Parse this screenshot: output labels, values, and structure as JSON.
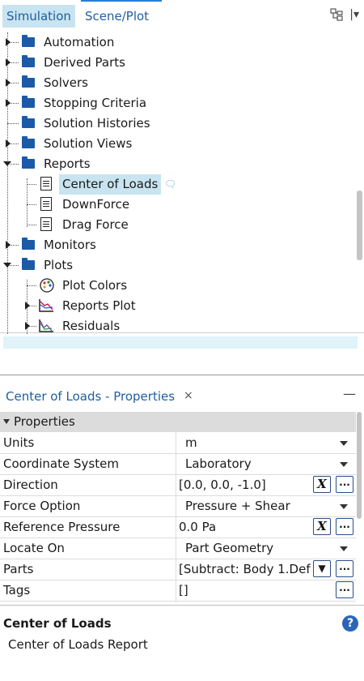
{
  "tabs": [
    {
      "label": "Simulation"
    },
    {
      "label": "Scene/Plot"
    }
  ],
  "tree": {
    "items": [
      {
        "label": "Automation"
      },
      {
        "label": "Derived Parts"
      },
      {
        "label": "Solvers"
      },
      {
        "label": "Stopping Criteria"
      },
      {
        "label": "Solution Histories"
      },
      {
        "label": "Solution Views"
      },
      {
        "label": "Reports"
      },
      {
        "label": "Center of Loads"
      },
      {
        "label": "DownForce"
      },
      {
        "label": "Drag Force"
      },
      {
        "label": "Monitors"
      },
      {
        "label": "Plots"
      },
      {
        "label": "Plot Colors"
      },
      {
        "label": "Reports Plot"
      },
      {
        "label": "Residuals"
      }
    ]
  },
  "properties": {
    "panel_title": "Center of Loads - Properties",
    "close_glyph": "×",
    "minimize_glyph": "—",
    "section_label": "Properties",
    "rows": [
      {
        "name": "Units",
        "value": "m"
      },
      {
        "name": "Coordinate System",
        "value": "Laboratory"
      },
      {
        "name": "Direction",
        "value": "[0.0, 0.0, -1.0]"
      },
      {
        "name": "Force Option",
        "value": "Pressure + Shear"
      },
      {
        "name": "Reference Pressure",
        "value": "0.0 Pa"
      },
      {
        "name": "Locate On",
        "value": "Part Geometry"
      },
      {
        "name": "Parts",
        "value": "[Subtract: Body 1.Def"
      },
      {
        "name": "Tags",
        "value": "[]"
      }
    ],
    "btn_x": "X",
    "btn_dots": "...",
    "btn_filter": "▼"
  },
  "description": {
    "title": "Center of Loads",
    "text": "Center of Loads Report",
    "help": "?"
  },
  "colors": {
    "accent": "#1f5fa0",
    "selection": "#c8e4f0",
    "folder": "#1c5aa8"
  }
}
